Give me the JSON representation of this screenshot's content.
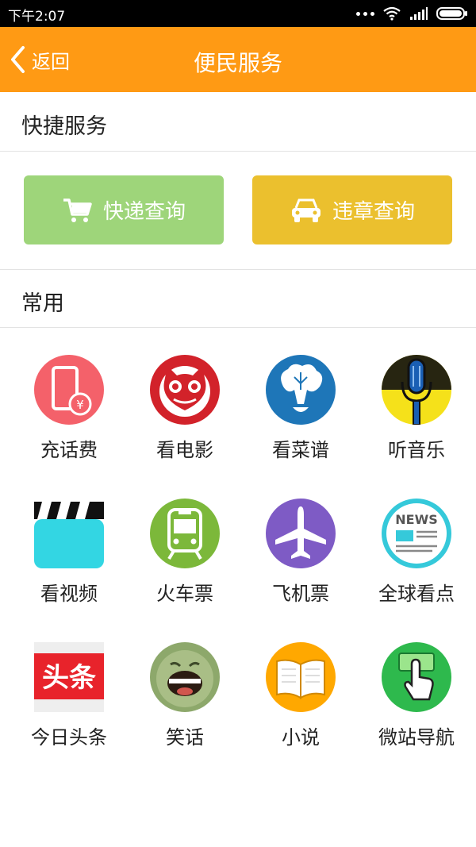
{
  "status_bar": {
    "time": "下午2:07"
  },
  "header": {
    "back_label": "返回",
    "title": "便民服务"
  },
  "quick_section": {
    "title": "快捷服务",
    "buttons": [
      {
        "label": "快递查询",
        "icon": "shopping-cart-icon",
        "color": "#9ED57A"
      },
      {
        "label": "违章查询",
        "icon": "car-icon",
        "color": "#EBC02E"
      }
    ]
  },
  "common_section": {
    "title": "常用",
    "items": [
      {
        "label": "充话费",
        "icon": "phone-recharge-icon"
      },
      {
        "label": "看电影",
        "icon": "cat-movie-icon"
      },
      {
        "label": "看菜谱",
        "icon": "vegetable-recipe-icon"
      },
      {
        "label": "听音乐",
        "icon": "microphone-icon"
      },
      {
        "label": "看视频",
        "icon": "clapperboard-icon"
      },
      {
        "label": "火车票",
        "icon": "train-icon"
      },
      {
        "label": "飞机票",
        "icon": "airplane-icon"
      },
      {
        "label": "全球看点",
        "icon": "news-icon"
      },
      {
        "label": "今日头条",
        "icon": "toutiao-icon",
        "logo_text": "头条"
      },
      {
        "label": "笑话",
        "icon": "laughing-face-icon"
      },
      {
        "label": "小说",
        "icon": "book-icon"
      },
      {
        "label": "微站导航",
        "icon": "touch-hand-icon"
      }
    ]
  },
  "colors": {
    "header": "#FF9A14",
    "express": "#9ED57A",
    "violation": "#EBC02E"
  }
}
